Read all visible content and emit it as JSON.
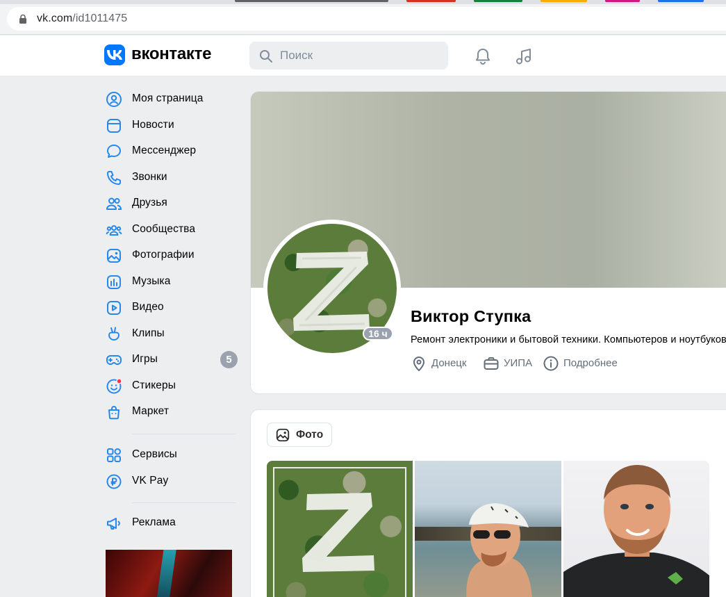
{
  "browser": {
    "url_host": "vk.com",
    "url_path": "/id1011475"
  },
  "header": {
    "brand": "вконтакте",
    "search_placeholder": "Поиск",
    "icons": [
      "bell-icon",
      "music-icon"
    ]
  },
  "sidebar": {
    "items": [
      {
        "label": "Моя страница",
        "icon": "user-circle-icon"
      },
      {
        "label": "Новости",
        "icon": "news-icon"
      },
      {
        "label": "Мессенджер",
        "icon": "message-icon"
      },
      {
        "label": "Звонки",
        "icon": "phone-icon"
      },
      {
        "label": "Друзья",
        "icon": "friends-icon"
      },
      {
        "label": "Сообщества",
        "icon": "communities-icon"
      },
      {
        "label": "Фотографии",
        "icon": "photo-icon"
      },
      {
        "label": "Музыка",
        "icon": "music-bars-icon"
      },
      {
        "label": "Видео",
        "icon": "video-icon"
      },
      {
        "label": "Клипы",
        "icon": "clips-icon"
      },
      {
        "label": "Игры",
        "icon": "gamepad-icon",
        "count": "5"
      },
      {
        "label": "Стикеры",
        "icon": "sticker-icon"
      },
      {
        "label": "Маркет",
        "icon": "market-icon"
      }
    ],
    "services": [
      {
        "label": "Сервисы",
        "icon": "services-icon"
      },
      {
        "label": "VK Pay",
        "icon": "vkpay-icon"
      }
    ],
    "ads": {
      "label": "Реклама",
      "icon": "megaphone-icon"
    }
  },
  "profile": {
    "name": "Виктор Ступка",
    "status": "Ремонт электроники и бытовой техники. Компьютеров и ноутбуков",
    "last_seen": "16 ч",
    "city": "Донецк",
    "work": "УИПА",
    "details": "Подробнее"
  },
  "photos": {
    "tab_label": "Фото"
  },
  "colors": {
    "accent": "#0077ff",
    "page_bg": "#edeef0",
    "secondary_text": "#626d7a",
    "counter_bg": "#99a2ad",
    "notification_dot": "#ff3347"
  }
}
